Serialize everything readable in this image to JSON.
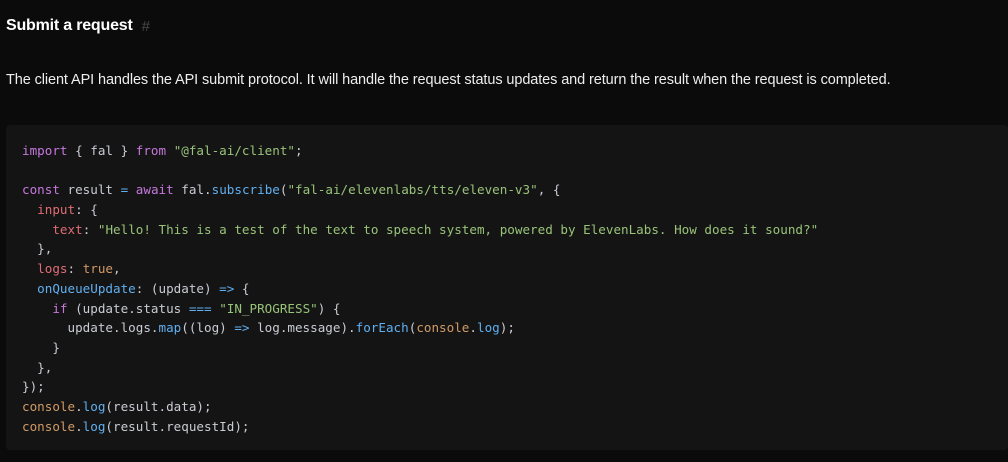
{
  "section": {
    "title": "Submit a request",
    "anchor": "#",
    "description": "The client API handles the API submit protocol. It will handle the request status updates and return the result when the request is completed."
  },
  "code": {
    "language": "javascript",
    "lines": [
      [
        [
          "k",
          "import"
        ],
        [
          "t",
          " { fal } "
        ],
        [
          "k",
          "from"
        ],
        [
          "t",
          " "
        ],
        [
          "s",
          "\"@fal-ai/client\""
        ],
        [
          "t",
          ";"
        ]
      ],
      [],
      [
        [
          "c",
          "const"
        ],
        [
          "t",
          " result "
        ],
        [
          "o",
          "="
        ],
        [
          "t",
          " "
        ],
        [
          "k",
          "await"
        ],
        [
          "t",
          " fal."
        ],
        [
          "f",
          "subscribe"
        ],
        [
          "t",
          "("
        ],
        [
          "s",
          "\"fal-ai/elevenlabs/tts/eleven-v3\""
        ],
        [
          "t",
          ", {"
        ]
      ],
      [
        [
          "t",
          "  "
        ],
        [
          "p",
          "input"
        ],
        [
          "t",
          ": {"
        ]
      ],
      [
        [
          "t",
          "    "
        ],
        [
          "p",
          "text"
        ],
        [
          "t",
          ": "
        ],
        [
          "s",
          "\"Hello! This is a test of the text to speech system, powered by ElevenLabs. How does it sound?\""
        ]
      ],
      [
        [
          "t",
          "  },"
        ]
      ],
      [
        [
          "t",
          "  "
        ],
        [
          "p",
          "logs"
        ],
        [
          "t",
          ": "
        ],
        [
          "b",
          "true"
        ],
        [
          "t",
          ","
        ]
      ],
      [
        [
          "t",
          "  "
        ],
        [
          "f",
          "onQueueUpdate"
        ],
        [
          "t",
          ": (update) "
        ],
        [
          "o",
          "=>"
        ],
        [
          "t",
          " {"
        ]
      ],
      [
        [
          "t",
          "    "
        ],
        [
          "k",
          "if"
        ],
        [
          "t",
          " (update.status "
        ],
        [
          "o",
          "==="
        ],
        [
          "t",
          " "
        ],
        [
          "s",
          "\"IN_PROGRESS\""
        ],
        [
          "t",
          ") {"
        ]
      ],
      [
        [
          "t",
          "      update.logs."
        ],
        [
          "f",
          "map"
        ],
        [
          "t",
          "((log) "
        ],
        [
          "o",
          "=>"
        ],
        [
          "t",
          " log.message)."
        ],
        [
          "f",
          "forEach"
        ],
        [
          "t",
          "("
        ],
        [
          "b",
          "console"
        ],
        [
          "t",
          "."
        ],
        [
          "f",
          "log"
        ],
        [
          "t",
          ");"
        ]
      ],
      [
        [
          "t",
          "    }"
        ]
      ],
      [
        [
          "t",
          "  },"
        ]
      ],
      [
        [
          "t",
          "});"
        ]
      ],
      [
        [
          "b",
          "console"
        ],
        [
          "t",
          "."
        ],
        [
          "f",
          "log"
        ],
        [
          "t",
          "(result.data);"
        ]
      ],
      [
        [
          "b",
          "console"
        ],
        [
          "t",
          "."
        ],
        [
          "f",
          "log"
        ],
        [
          "t",
          "(result.requestId);"
        ]
      ]
    ]
  }
}
